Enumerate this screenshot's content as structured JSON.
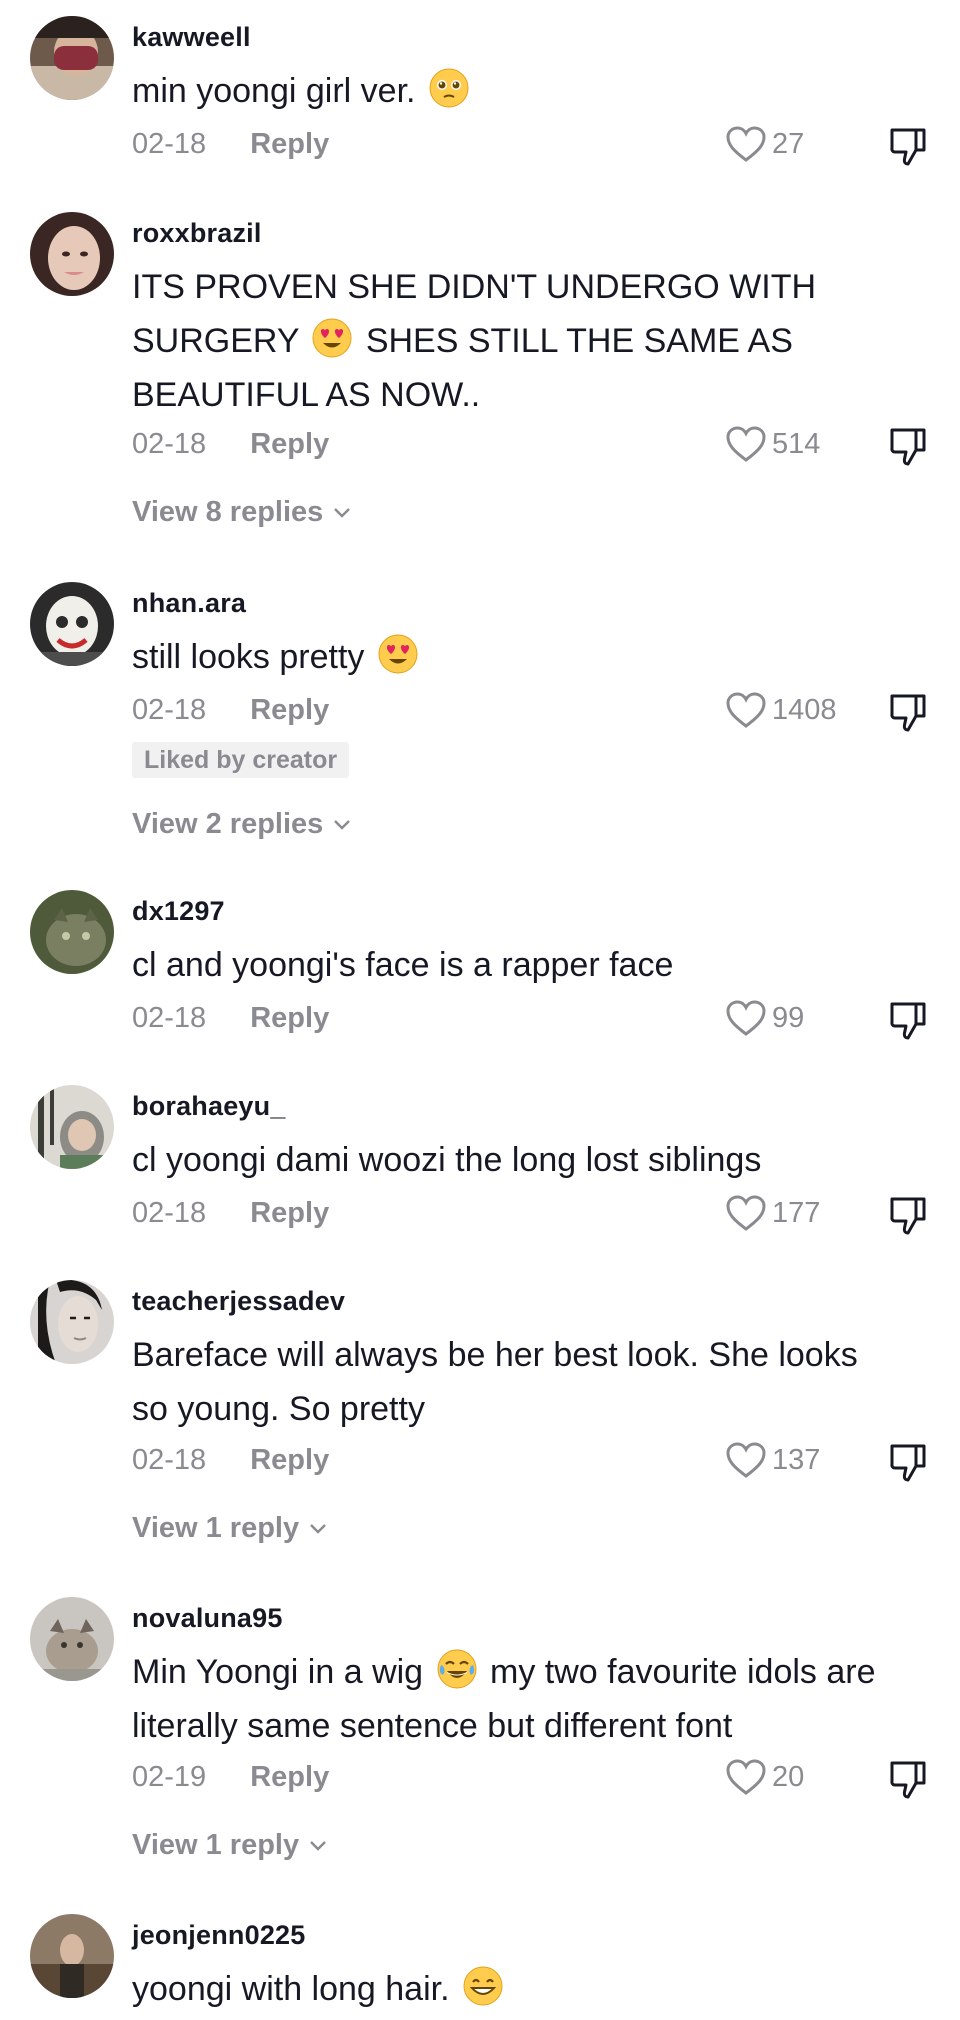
{
  "comments": [
    {
      "username": "kawweell",
      "text_parts": [
        "min yoongi girl ver."
      ],
      "date": "02-18",
      "reply_label": "Reply",
      "likes": "27",
      "avatar_colors": [
        "#6e5a4b",
        "#8c2f3d",
        "#c9b8a6"
      ]
    },
    {
      "username": "roxxbrazil",
      "text_line1": "ITS PROVEN SHE DIDN'T UNDERGO WITH",
      "text_line2a": "SURGERY",
      "text_line2b": "SHES STILL THE SAME AS",
      "text_line3": "BEAUTIFUL AS NOW..",
      "date": "02-18",
      "reply_label": "Reply",
      "likes": "514",
      "view_replies": "View 8 replies",
      "avatar_colors": [
        "#e7c9b9",
        "#3a2622",
        "#d98c8c"
      ]
    },
    {
      "username": "nhan.ara",
      "text": "still looks pretty",
      "date": "02-18",
      "reply_label": "Reply",
      "likes": "1408",
      "badge": "Liked by creator",
      "view_replies": "View 2 replies",
      "avatar_colors": [
        "#f1efe9",
        "#2b2b2b",
        "#c62a2a"
      ]
    },
    {
      "username": "dx1297",
      "text": "cl and yoongi's face is a rapper face",
      "date": "02-18",
      "reply_label": "Reply",
      "likes": "99",
      "avatar_colors": [
        "#4f5a3a",
        "#7b7f62",
        "#c6c9a8"
      ]
    },
    {
      "username": "borahaeyu_",
      "text": "cl yoongi dami woozi the long lost siblings",
      "date": "02-18",
      "reply_label": "Reply",
      "likes": "177",
      "avatar_colors": [
        "#dcd8d2",
        "#3b3d38",
        "#8d8b86"
      ]
    },
    {
      "username": "teacherjessadev",
      "text_line1": "Bareface will always be her best look. She looks",
      "text_line2": "so young. So pretty",
      "date": "02-18",
      "reply_label": "Reply",
      "likes": "137",
      "view_replies": "View 1 reply",
      "avatar_colors": [
        "#d8d4d1",
        "#1d1b1a",
        "#8e8682"
      ]
    },
    {
      "username": "novaluna95",
      "text_line1a": "Min Yoongi in a wig",
      "text_line1b": "my two favourite idols are",
      "text_line2": "literally same sentence but different font",
      "date": "02-19",
      "reply_label": "Reply",
      "likes": "20",
      "view_replies": "View 1 reply",
      "avatar_colors": [
        "#c9c5c0",
        "#6f655c",
        "#a99d90"
      ]
    },
    {
      "username": "jeonjenn0225",
      "text": "yoongi with long hair.",
      "avatar_colors": [
        "#5a4634",
        "#8c7a66",
        "#2f2a24"
      ]
    }
  ]
}
